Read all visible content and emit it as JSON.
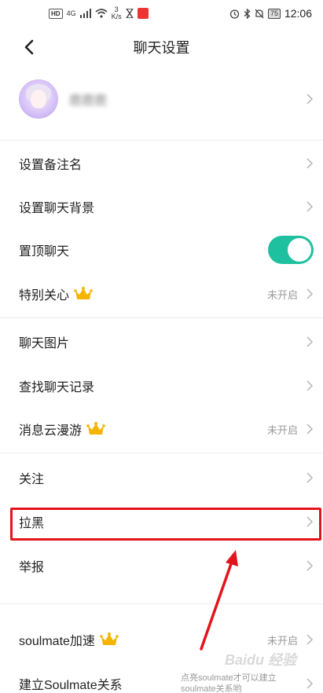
{
  "status_bar": {
    "hd": "HD",
    "signal": "4G",
    "speed_top": "3",
    "speed_unit": "K/s",
    "battery": "75",
    "time": "12:06"
  },
  "nav": {
    "title": "聊天设置"
  },
  "profile": {
    "name": "鹿鹿鹿"
  },
  "rows": {
    "remark": "设置备注名",
    "background": "设置聊天背景",
    "pin": "置顶聊天",
    "special": "特别关心",
    "special_value": "未开启",
    "images": "聊天图片",
    "search": "查找聊天记录",
    "cloud": "消息云漫游",
    "cloud_value": "未开启",
    "follow": "关注",
    "block": "拉黑",
    "report": "举报",
    "soulmate_speed": "soulmate加速",
    "soulmate_speed_value": "未开启",
    "soulmate_relation": "建立Soulmate关系",
    "soulmate_hint": "点亮soulmate才可以建立soulmate关系哟"
  },
  "toggles": {
    "pin_on": true
  },
  "colors": {
    "accent": "#1ec0a0",
    "highlight": "#e3141c",
    "crown": "#f5b400"
  },
  "watermark": "Baidu 经验"
}
